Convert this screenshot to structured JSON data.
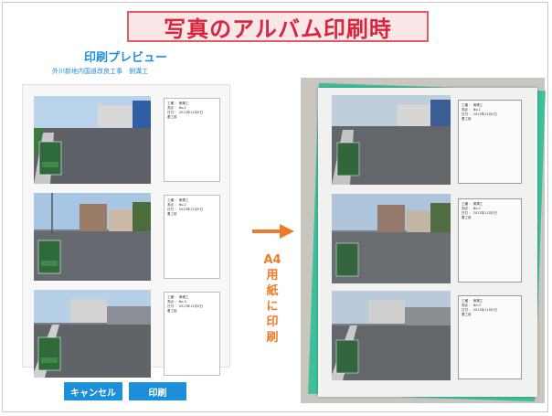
{
  "banner": {
    "title": "写真のアルバム印刷時"
  },
  "preview": {
    "title": "印刷プレビュー",
    "subtitle": "外川新地内国道改良工事　側溝工",
    "rows": [
      {
        "lines": [
          "工種 ： 側溝工",
          "測点 ： No.1",
          "日付 ： 2013年11月5日",
          "着工前"
        ]
      },
      {
        "lines": [
          "工種 ： 側溝工",
          "測点 ： No.2",
          "日付 ： 2013年11月5日",
          "着工前"
        ]
      },
      {
        "lines": [
          "工種 ： 側溝工",
          "測点 ： No.3",
          "日付 ： 2013年11月5日",
          "着工前"
        ]
      }
    ]
  },
  "buttons": {
    "cancel": "キャンセル",
    "print": "印刷"
  },
  "annotation": {
    "text": "A4用紙に印刷"
  },
  "printed": {
    "rows": [
      {
        "lines": [
          "工種 ： 側溝工",
          "測点 ： No.1",
          "日付 ： 2013年11月5日",
          "着工前"
        ]
      },
      {
        "lines": [
          "工種 ： 側溝工",
          "測点 ： No.2",
          "日付 ： 2013年11月5日",
          "着工前"
        ]
      },
      {
        "lines": [
          "工種 ： 側溝工",
          "測点 ： No.3",
          "日付 ： 2013年11月5日",
          "着工前"
        ]
      }
    ]
  },
  "colors": {
    "accent": "#1c8fd8",
    "banner_red": "#d7263d",
    "arrow_orange": "#f07a2a",
    "green_card": "#3fbf9a"
  }
}
